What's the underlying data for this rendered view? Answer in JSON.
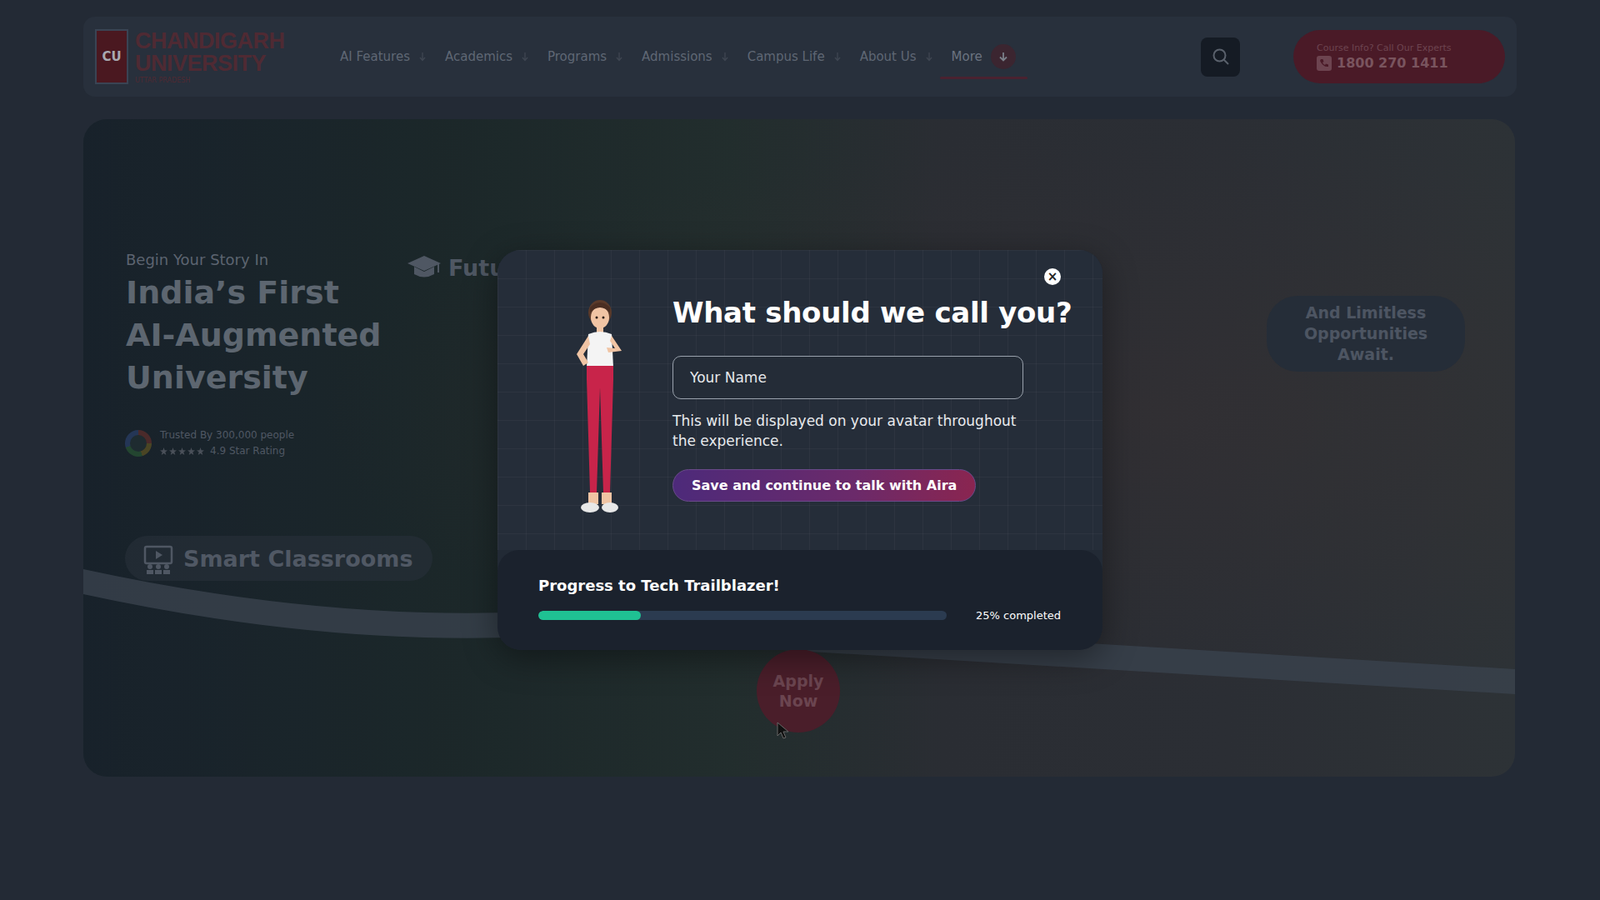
{
  "header": {
    "logo": {
      "mark": "CU",
      "line1": "CHANDIGARH",
      "line2": "UNIVERSITY",
      "sub": "UTTAR PRADESH"
    },
    "nav": [
      {
        "label": "AI Features",
        "selected": false
      },
      {
        "label": "Academics",
        "selected": false
      },
      {
        "label": "Programs",
        "selected": false
      },
      {
        "label": "Admissions",
        "selected": false
      },
      {
        "label": "Campus Life",
        "selected": false
      },
      {
        "label": "About Us",
        "selected": false
      },
      {
        "label": "More",
        "selected": true
      }
    ],
    "call": {
      "caption": "Course Info? Call Our Experts",
      "number": "1800 270 1411"
    }
  },
  "hero": {
    "eyebrow": "Begin Your Story In",
    "title_lines": [
      "India’s First",
      "AI-Augmented",
      "University"
    ],
    "rating": {
      "trusted": "Trusted By 300,000 people",
      "stars": 5,
      "score": "4.9 Star Rating"
    },
    "features": [
      "Smart Classrooms",
      "Futu"
    ],
    "tagline": "And Limitless Opportunities Await.",
    "apply": "Apply Now"
  },
  "modal": {
    "close": "×",
    "title": "What should we call you?",
    "input": {
      "placeholder": "Your Name"
    },
    "helper": "This will be displayed on your avatar throughout the experience.",
    "button": "Save and continue to talk with Aira",
    "progress": {
      "title": "Progress to Tech Trailblazer!",
      "level": 0.25,
      "reading": "25% completed"
    }
  }
}
